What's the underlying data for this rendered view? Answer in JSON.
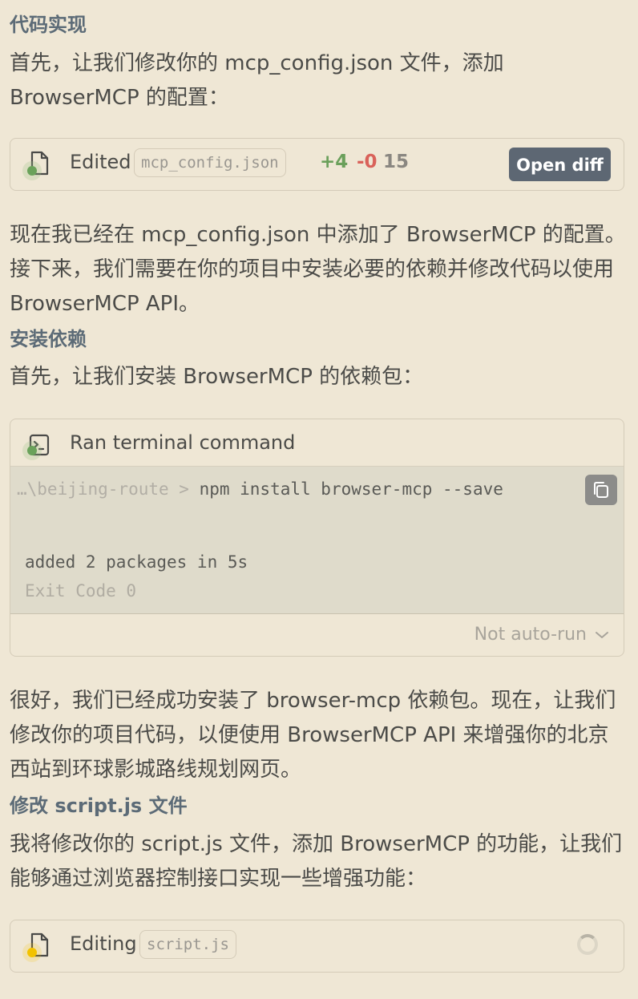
{
  "sections": {
    "impl_heading": "代码实现",
    "impl_para": "首先，让我们修改你的 mcp_config.json 文件，添加 BrowserMCP 的配置：",
    "edited_card": {
      "label": "Edited",
      "file": "mcp_config.json",
      "added": "+4",
      "removed": "-0",
      "count": "15",
      "button": "Open diff"
    },
    "after_edit_para": "现在我已经在 mcp_config.json 中添加了 BrowserMCP 的配置。接下来，我们需要在你的项目中安装必要的依赖并修改代码以使用 BrowserMCP API。",
    "install_heading": "安装依赖",
    "install_para": "首先，让我们安装 BrowserMCP 的依赖包：",
    "terminal_card": {
      "label": "Ran terminal command",
      "path": "…\\beijing-route > ",
      "command": "npm install browser-mcp --save",
      "output_line1": "added 2 packages in 5s",
      "output_line2": "Exit Code 0",
      "autorun": "Not auto-run"
    },
    "after_install_para": "很好，我们已经成功安装了 browser-mcp 依赖包。现在，让我们修改你的项目代码，以便使用 BrowserMCP API 来增强你的北京西站到环球影城路线规划网页。",
    "script_heading": "修改 script.js 文件",
    "script_para": "我将修改你的 script.js 文件，添加 BrowserMCP 的功能，让我们能够通过浏览器控制接口实现一些增强功能：",
    "editing_card": {
      "label": "Editing",
      "file": "script.js"
    }
  },
  "icons": {
    "file": "file-icon",
    "terminal": "terminal-icon",
    "copy": "copy-icon",
    "chevron": "chevron-down-icon",
    "spinner": "loading-spinner"
  },
  "colors": {
    "background": "#efe7d5",
    "heading": "#5c6b77",
    "diff_added": "#6ba05b",
    "diff_removed": "#d9625a",
    "button_bg": "#5d6773",
    "status_green": "#6aa25a",
    "status_yellow": "#f2c200"
  }
}
